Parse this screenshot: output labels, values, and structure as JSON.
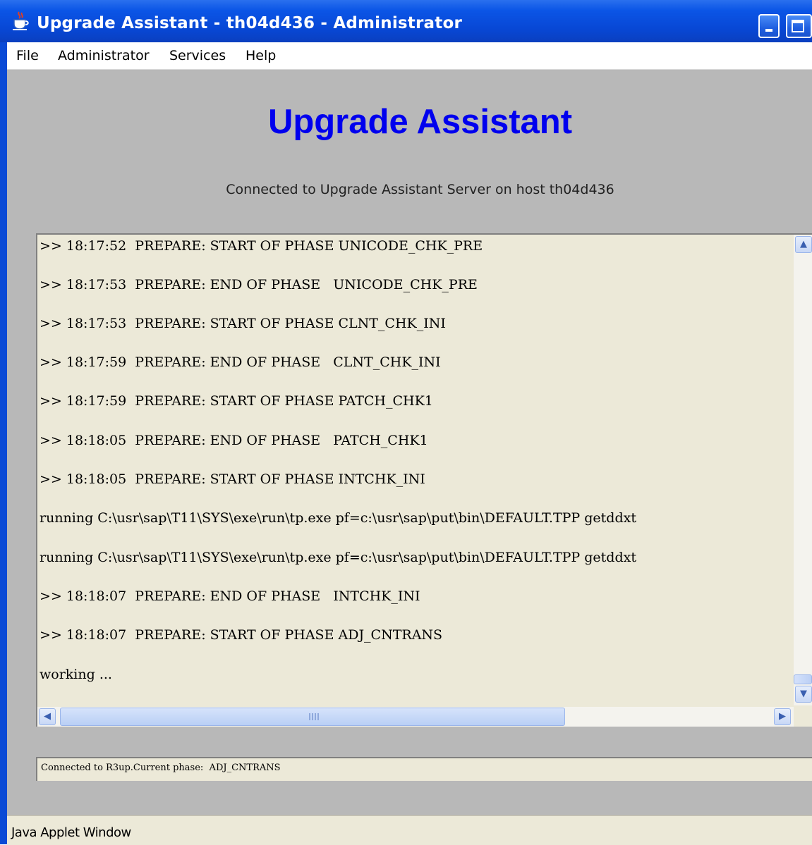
{
  "window": {
    "title": "Upgrade Assistant - th04d436 - Administrator",
    "icon": "java-cup-icon"
  },
  "menubar": {
    "items": [
      "File",
      "Administrator",
      "Services",
      "Help"
    ]
  },
  "main": {
    "heading": "Upgrade Assistant",
    "connection_text": "Connected to Upgrade Assistant Server on host th04d436",
    "log_lines": [
      ">> 18:17:52  PREPARE: START OF PHASE UNICODE_CHK_PRE",
      ">> 18:17:53  PREPARE: END OF PHASE   UNICODE_CHK_PRE",
      ">> 18:17:53  PREPARE: START OF PHASE CLNT_CHK_INI",
      ">> 18:17:59  PREPARE: END OF PHASE   CLNT_CHK_INI",
      ">> 18:17:59  PREPARE: START OF PHASE PATCH_CHK1",
      ">> 18:18:05  PREPARE: END OF PHASE   PATCH_CHK1",
      ">> 18:18:05  PREPARE: START OF PHASE INTCHK_INI",
      "running C:\\usr\\sap\\T11\\SYS\\exe\\run\\tp.exe pf=c:\\usr\\sap\\put\\bin\\DEFAULT.TPP getddxt",
      "running C:\\usr\\sap\\T11\\SYS\\exe\\run\\tp.exe pf=c:\\usr\\sap\\put\\bin\\DEFAULT.TPP getddxt",
      ">> 18:18:07  PREPARE: END OF PHASE   INTCHK_INI",
      ">> 18:18:07  PREPARE: START OF PHASE ADJ_CNTRANS",
      "working ..."
    ],
    "status_text": "Connected to R3up.Current phase:  ADJ_CNTRANS"
  },
  "footer": {
    "applet_text": "Java Applet Window"
  }
}
